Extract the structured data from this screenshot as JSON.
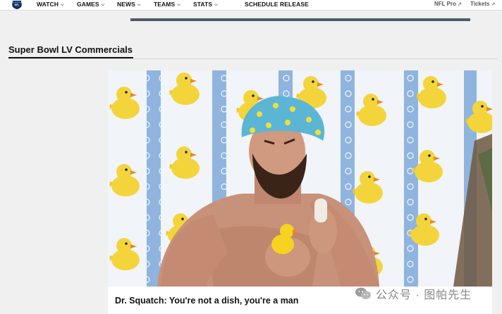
{
  "nav": {
    "logo_text": "NFL",
    "items": [
      {
        "label": "WATCH",
        "has_dropdown": true
      },
      {
        "label": "GAMES",
        "has_dropdown": true
      },
      {
        "label": "NEWS",
        "has_dropdown": true
      },
      {
        "label": "TEAMS",
        "has_dropdown": true
      },
      {
        "label": "STATS",
        "has_dropdown": true
      }
    ],
    "schedule_release": "SCHEDULE RELEASE",
    "right_links": [
      {
        "label": "NFL Pro",
        "external": true
      },
      {
        "label": "Tickets",
        "external": true
      }
    ]
  },
  "section": {
    "title": "Super Bowl LV Commercials"
  },
  "card": {
    "title": "Dr. Squatch: You're not a dish, you're a man",
    "image_alt": "Bearded man in a duck-print shower cap holding a rubber duck and a bar of soap in front of a rubber duck shower curtain"
  },
  "watermark": {
    "text": "公众号 · 图帕先生"
  },
  "colors": {
    "page_bg": "#f0f0f0",
    "nav_bg": "#ffffff",
    "promo_bar": "#4e5a68",
    "curtain_stripe": "#8fb4de",
    "duck_yellow": "#f3d53b"
  }
}
